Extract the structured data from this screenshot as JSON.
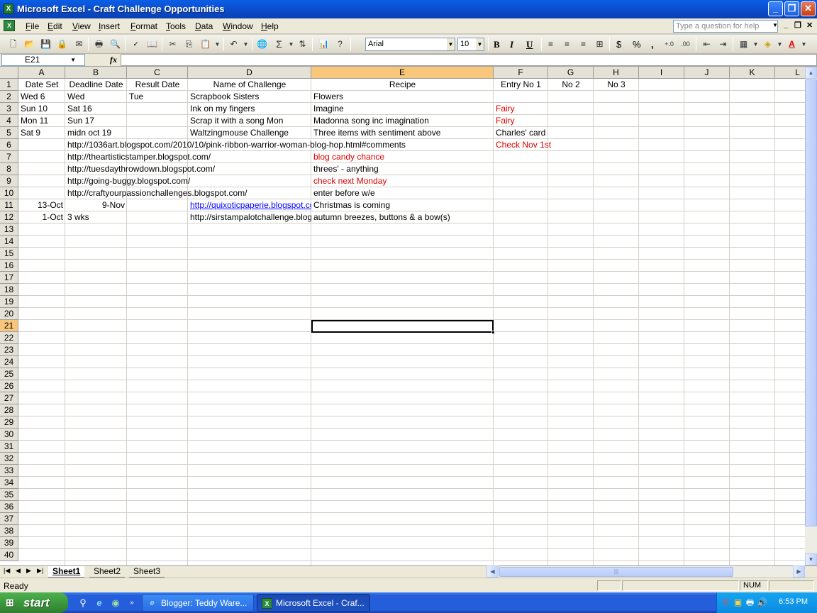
{
  "window": {
    "title": "Microsoft Excel - Craft Challenge Opportunities"
  },
  "menu": [
    "File",
    "Edit",
    "View",
    "Insert",
    "Format",
    "Tools",
    "Data",
    "Window",
    "Help"
  ],
  "help_box": {
    "placeholder": "Type a question for help"
  },
  "toolbar": {
    "font_name": "Arial",
    "font_size": "10",
    "bold": "B",
    "italic": "I",
    "underline": "U",
    "currency": "$",
    "percent": "%",
    "comma": ","
  },
  "formula_bar": {
    "name_box": "E21",
    "fx": "fx",
    "content": ""
  },
  "columns": [
    "A",
    "B",
    "C",
    "D",
    "E",
    "F",
    "G",
    "H",
    "I",
    "J",
    "K",
    "L"
  ],
  "selected_column": "E",
  "selected_row": "21",
  "rows": [
    "1",
    "2",
    "3",
    "4",
    "5",
    "6",
    "7",
    "8",
    "9",
    "10",
    "11",
    "12",
    "13",
    "14",
    "15",
    "16",
    "17",
    "18",
    "19",
    "20",
    "21",
    "22",
    "23",
    "24",
    "25",
    "26",
    "27",
    "28",
    "29",
    "30",
    "31",
    "32",
    "33",
    "34",
    "35",
    "36",
    "37",
    "38",
    "39",
    "40"
  ],
  "cells": {
    "A1": "Date Set",
    "B1": "Deadline Date",
    "C1": "Result Date",
    "D1": "Name of Challenge",
    "E1": "Recipe",
    "F1": "Entry No 1",
    "G1": "No 2",
    "H1": "No 3",
    "A2": "Wed 6",
    "B2": "Wed",
    "C2": "Tue",
    "D2": "Scrapbook Sisters",
    "E2": "Flowers",
    "A3": "Sun 10",
    "B3": "Sat 16",
    "D3": "Ink on my fingers",
    "E3": "Imagine",
    "F3": "Fairy",
    "A4": "Mon 11",
    "B4": "Sun 17",
    "D4": "Scrap it with a song Mon",
    "E4": "Madonna song inc imagination",
    "F4": "Fairy",
    "A5": "Sat 9",
    "B5": "midn oct 19",
    "D5": "Waltzingmouse Challenge",
    "E5": "Three items with sentiment above",
    "F5": "Charles' card",
    "B6": "http://1036art.blogspot.com/2010/10/pink-ribbon-warrior-woman-blog-hop.html#comments",
    "F6": "Check Nov 1st",
    "B7": "http://theartisticstamper.blogspot.com/",
    "E7": "blog candy chance",
    "B8": "http://tuesdaythrowdown.blogspot.com/",
    "E8": "threes' - anything",
    "B9": "http://going-buggy.blogspot.com/",
    "E9": "check next Monday",
    "B10": "http://craftyourpassionchallenges.blogspot.com/",
    "E10": "enter before w/e",
    "A11": "13-Oct",
    "B11": "9-Nov",
    "D11": "http://quixoticpaperie.blogspot.com/",
    "E11": "Christmas is coming",
    "A12": "1-Oct",
    "B12": "3 wks",
    "D12": "http://sirstampalotchallenge.blogspot.com/",
    "E12": "autumn breezes, buttons & a bow(s)"
  },
  "sheets": [
    "Sheet1",
    "Sheet2",
    "Sheet3"
  ],
  "active_sheet": "Sheet1",
  "status": {
    "text": "Ready",
    "num": "NUM"
  },
  "taskbar": {
    "start": "start",
    "tasks": [
      "Blogger: Teddy Ware...",
      "Microsoft Excel - Craf..."
    ],
    "clock": "6:53 PM"
  },
  "colors": {
    "red_text": "#e00000",
    "link": "#0000ff",
    "selected_header": "#f8c77c"
  }
}
